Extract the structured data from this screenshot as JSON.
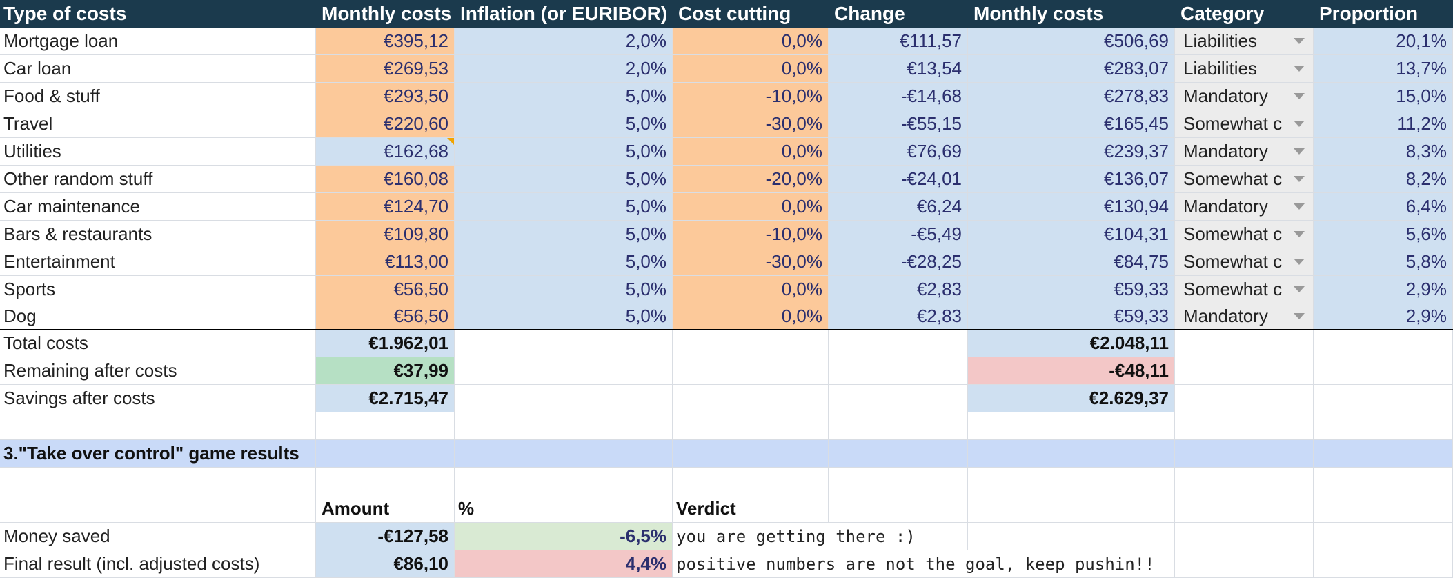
{
  "headers": [
    "Type of costs",
    "Monthly costs",
    "Inflation (or EURIBOR)",
    "Cost cutting",
    "Change",
    "Monthly costs",
    "Category",
    "Proportion"
  ],
  "rows": [
    {
      "name": "Mortgage loan",
      "monthly": "€395,12",
      "inflation": "2,0%",
      "cutting": "0,0%",
      "change": "€111,57",
      "adjusted": "€506,69",
      "category": "Liabilities",
      "proportion": "20,1%"
    },
    {
      "name": "Car loan",
      "monthly": "€269,53",
      "inflation": "2,0%",
      "cutting": "0,0%",
      "change": "€13,54",
      "adjusted": "€283,07",
      "category": "Liabilities",
      "proportion": "13,7%"
    },
    {
      "name": "Food & stuff",
      "monthly": "€293,50",
      "inflation": "5,0%",
      "cutting": "-10,0%",
      "change": "-€14,68",
      "adjusted": "€278,83",
      "category": "Mandatory",
      "proportion": "15,0%"
    },
    {
      "name": "Travel",
      "monthly": "€220,60",
      "inflation": "5,0%",
      "cutting": "-30,0%",
      "change": "-€55,15",
      "adjusted": "€165,45",
      "category": "Somewhat c",
      "proportion": "11,2%"
    },
    {
      "name": "Utilities",
      "monthly": "€162,68",
      "inflation": "5,0%",
      "cutting": "0,0%",
      "change": "€76,69",
      "adjusted": "€239,37",
      "category": "Mandatory",
      "proportion": "8,3%"
    },
    {
      "name": "Other random stuff",
      "monthly": "€160,08",
      "inflation": "5,0%",
      "cutting": "-20,0%",
      "change": "-€24,01",
      "adjusted": "€136,07",
      "category": "Somewhat c",
      "proportion": "8,2%"
    },
    {
      "name": "Car maintenance",
      "monthly": "€124,70",
      "inflation": "5,0%",
      "cutting": "0,0%",
      "change": "€6,24",
      "adjusted": "€130,94",
      "category": "Mandatory",
      "proportion": "6,4%"
    },
    {
      "name": "Bars & restaurants",
      "monthly": "€109,80",
      "inflation": "5,0%",
      "cutting": "-10,0%",
      "change": "-€5,49",
      "adjusted": "€104,31",
      "category": "Somewhat c",
      "proportion": "5,6%"
    },
    {
      "name": "Entertainment",
      "monthly": "€113,00",
      "inflation": "5,0%",
      "cutting": "-30,0%",
      "change": "-€28,25",
      "adjusted": "€84,75",
      "category": "Somewhat c",
      "proportion": "5,8%"
    },
    {
      "name": "Sports",
      "monthly": "€56,50",
      "inflation": "5,0%",
      "cutting": "0,0%",
      "change": "€2,83",
      "adjusted": "€59,33",
      "category": "Somewhat c",
      "proportion": "2,9%"
    },
    {
      "name": "Dog",
      "monthly": "€56,50",
      "inflation": "5,0%",
      "cutting": "0,0%",
      "change": "€2,83",
      "adjusted": "€59,33",
      "category": "Mandatory",
      "proportion": "2,9%"
    }
  ],
  "totals": {
    "total_label": "Total costs",
    "total_monthly": "€1.962,01",
    "total_adjusted": "€2.048,11",
    "remaining_label": "Remaining after costs",
    "remaining_monthly": "€37,99",
    "remaining_adjusted": "-€48,11",
    "savings_label": "Savings after costs",
    "savings_monthly": "€2.715,47",
    "savings_adjusted": "€2.629,37"
  },
  "section_title": "3.\"Take over control\" game results",
  "results": {
    "amount_header": "Amount",
    "percent_header": "%",
    "verdict_header": "Verdict",
    "money_saved_label": "Money saved",
    "money_saved_amount": "-€127,58",
    "money_saved_percent": "-6,5%",
    "money_saved_verdict": "you are getting there :)",
    "final_label": "Final result (incl. adjusted costs)",
    "final_amount": "€86,10",
    "final_percent": "4,4%",
    "final_verdict": "positive numbers are not the goal, keep pushin!!"
  },
  "colors": {
    "header_bg": "#1b3a4d",
    "input_orange": "#fcc99a",
    "calc_blue": "#cfe0f1",
    "positive_green": "#b6e0c4",
    "negative_pink": "#f3c7c7",
    "section_blue": "#c9daf8"
  }
}
